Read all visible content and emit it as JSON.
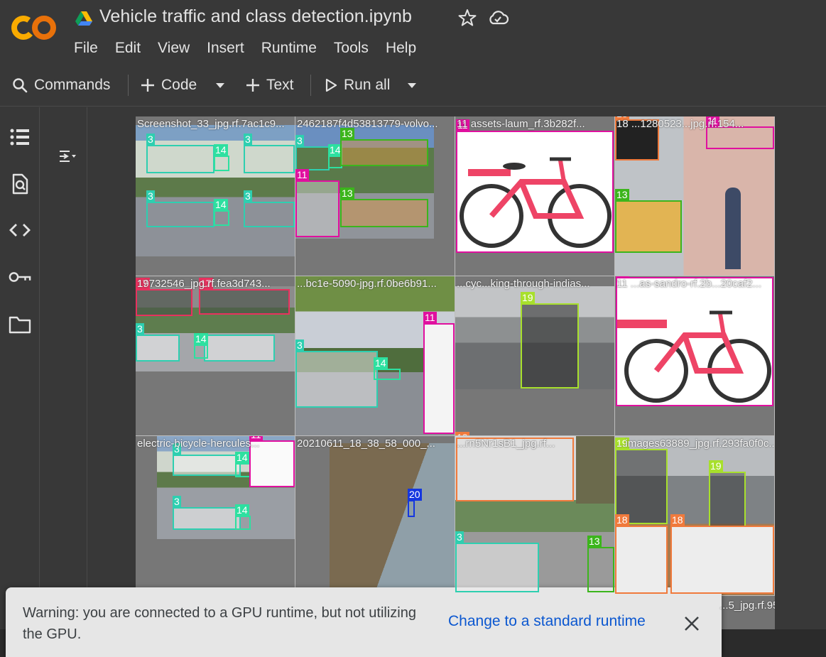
{
  "header": {
    "logo_text": "CO",
    "title": "Vehicle traffic and class detection.ipynb",
    "menu": [
      "File",
      "Edit",
      "View",
      "Insert",
      "Runtime",
      "Tools",
      "Help"
    ]
  },
  "toolbar": {
    "commands_label": "Commands",
    "code_label": "Code",
    "text_label": "Text",
    "run_all_label": "Run all"
  },
  "rail": {
    "icons": [
      "table-of-contents-icon",
      "find-replace-icon",
      "code-snippets-icon",
      "secrets-key-icon",
      "files-folder-icon"
    ]
  },
  "output": {
    "tiles": [
      {
        "label": "Screenshot_33_jpg.rf.7ac1c9...",
        "tags": [
          "3",
          "14",
          "3",
          "14",
          "3",
          "14",
          "3",
          "14"
        ]
      },
      {
        "label": "2462187f4d53813779-volvo...",
        "tags": [
          "3",
          "14",
          "13",
          "11",
          "13"
        ]
      },
      {
        "label": "11  assets-laum_rf.3b282f...",
        "tags": [
          "11"
        ]
      },
      {
        "label": "18  ...1280523...jpg.rf.154...",
        "tags": [
          "18",
          "11",
          "13"
        ]
      },
      {
        "label": "19732546_jpg.rf.fea3d743...",
        "tags": [
          "17",
          "17",
          "3",
          "14"
        ]
      },
      {
        "label": "...bc1e-5090-jpg.rf.0be6b91...",
        "tags": [
          "3",
          "14",
          "11"
        ]
      },
      {
        "label": "...cyc...king-through-indias...",
        "tags": [
          "19",
          "18"
        ]
      },
      {
        "label": "11  ...as-sandro-rf.2b...20caf2...",
        "tags": [
          "11"
        ]
      },
      {
        "label": "electric-bicycle-hercules...",
        "tags": [
          "3",
          "14",
          "3",
          "14",
          "11"
        ]
      },
      {
        "label": "20210611_18_38_58_000_...",
        "tags": [
          "20"
        ]
      },
      {
        "label": "...rn5Nr1sB1_jpg.rf...",
        "tags": [
          "3",
          "13"
        ]
      },
      {
        "label": "...images63889_jpg.rf.293fa0f0c...",
        "tags": [
          "19",
          "19",
          "18",
          "18"
        ]
      }
    ],
    "bottom_partial_label": "...5_jpg.rf.95..."
  },
  "toast": {
    "message": "Warning: you are connected to a GPU runtime, but not utilizing the GPU.",
    "action_label": "Change to a standard runtime"
  },
  "colors": {
    "class_3": "#2ecfb0",
    "class_11": "#e0109f",
    "class_13": "#3cb51c",
    "class_14": "#2de0a0",
    "class_17": "#e8315e",
    "class_18": "#f07a3c",
    "class_19": "#a8e02c",
    "class_20": "#1436e0"
  }
}
